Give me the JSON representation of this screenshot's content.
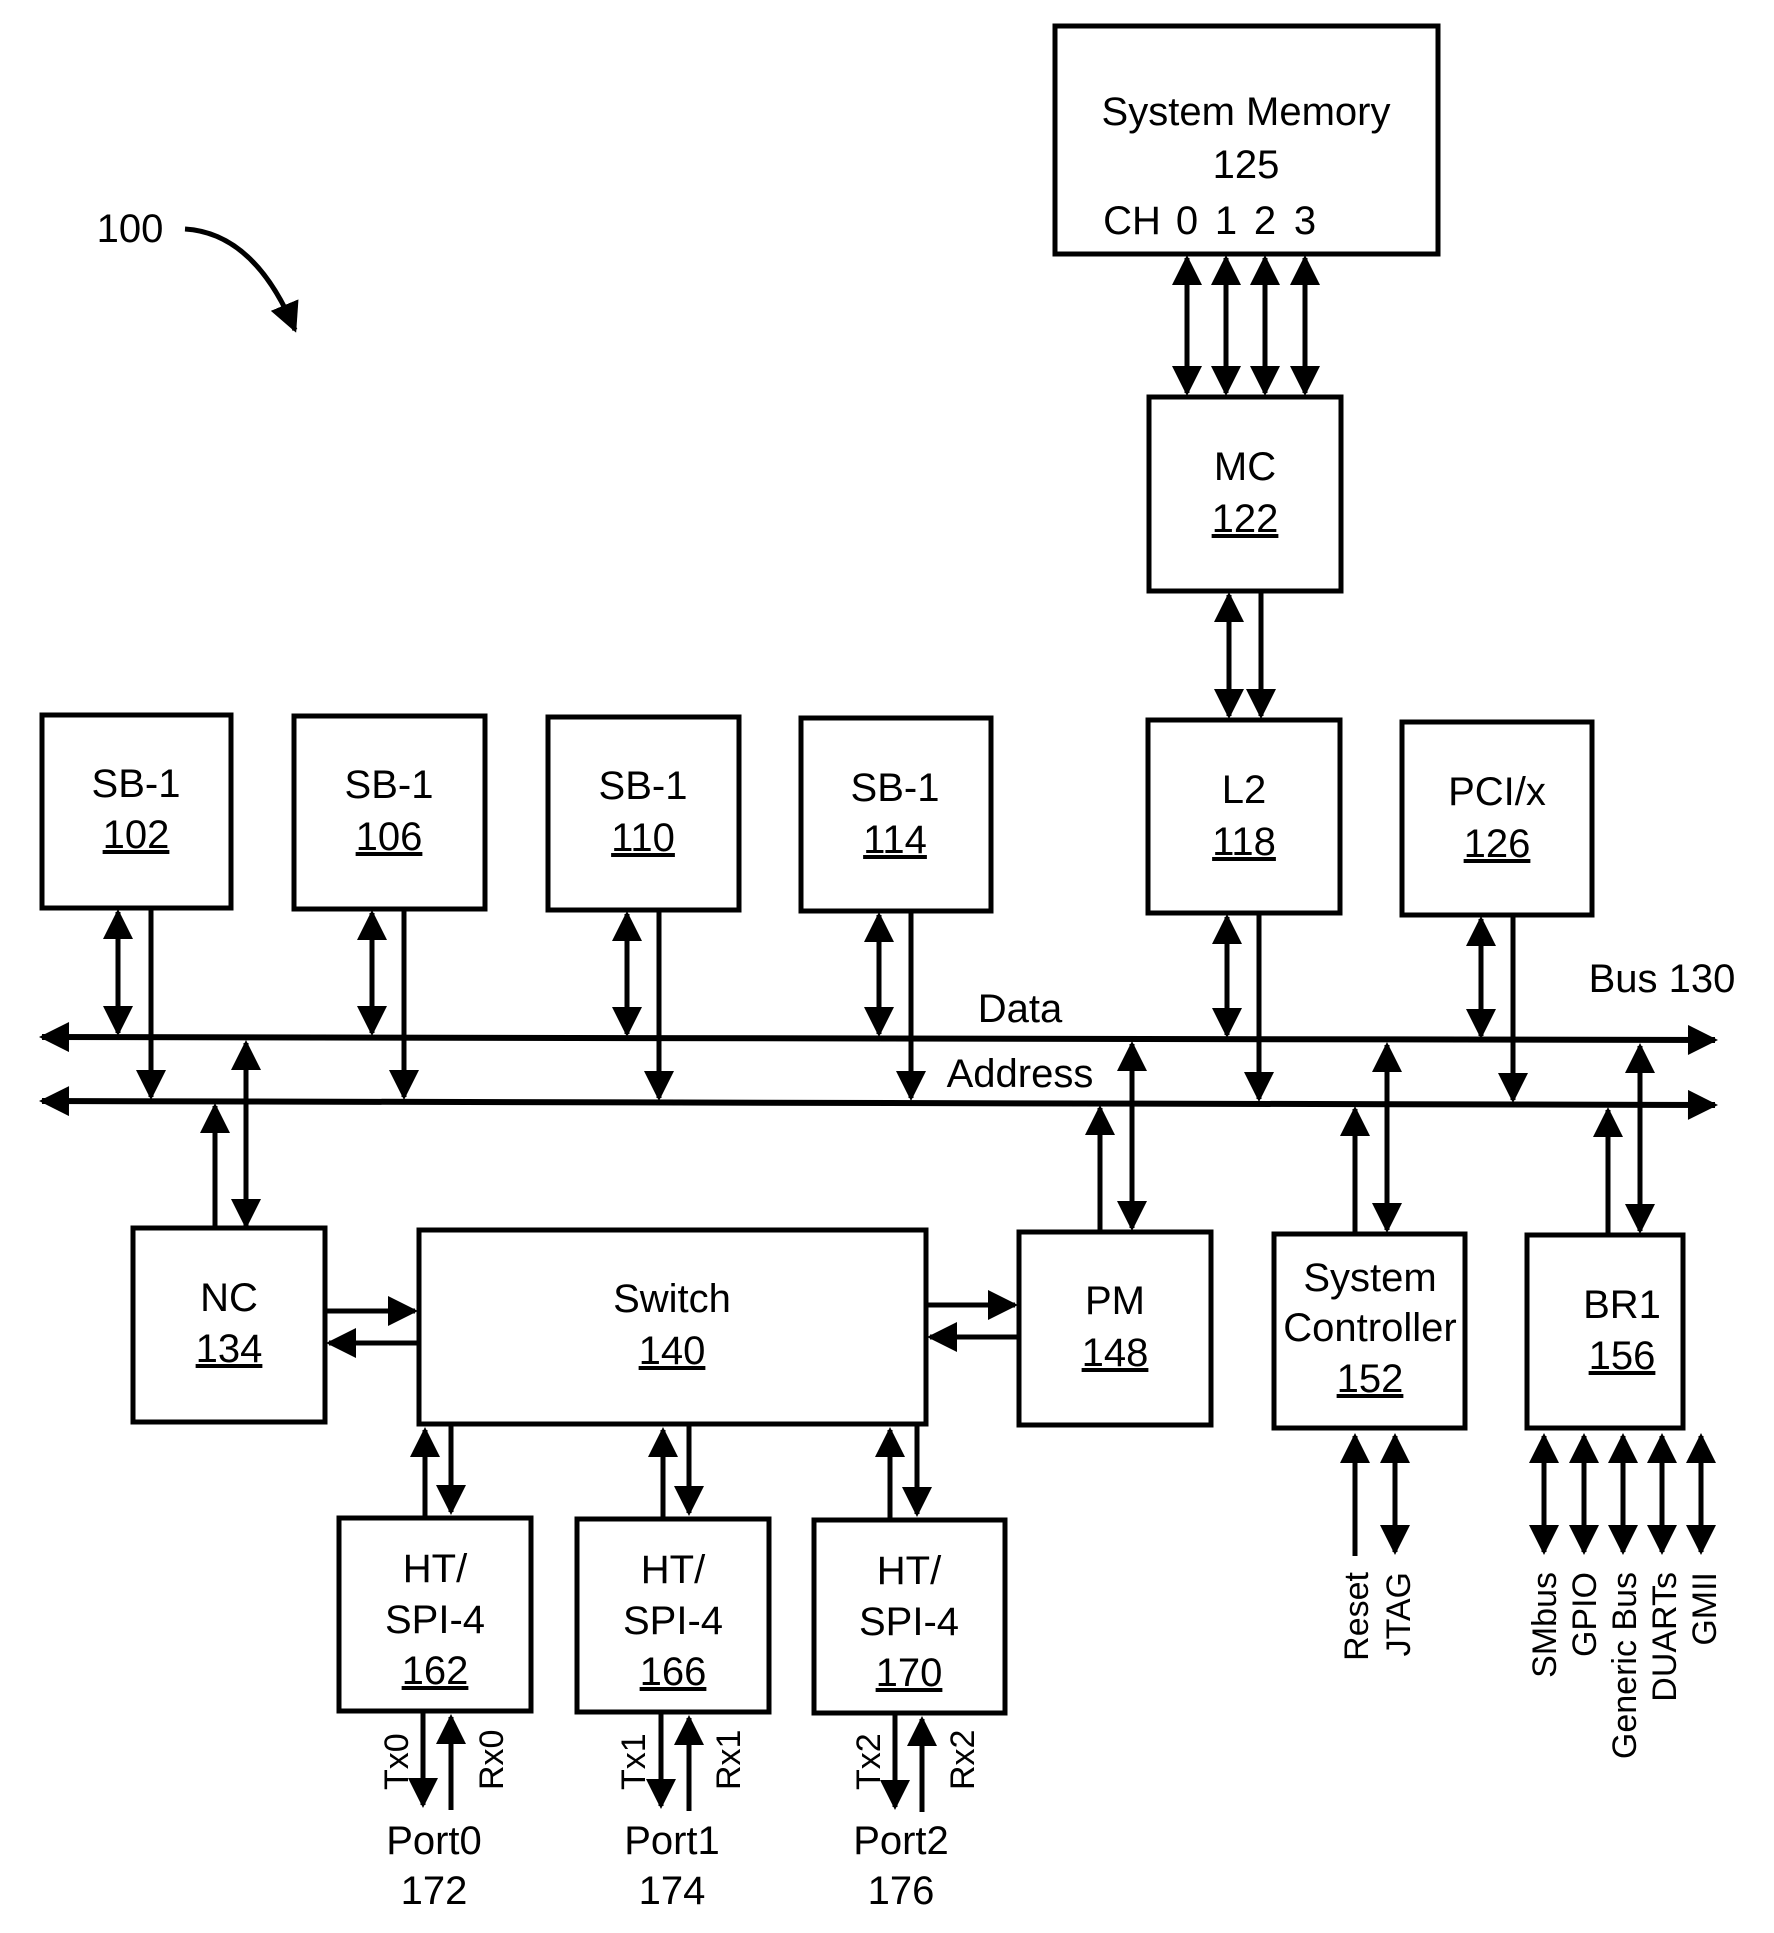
{
  "figure": {
    "reference_label": "100",
    "bus": {
      "label": "Bus 130",
      "data_label": "Data",
      "address_label": "Address"
    },
    "system_memory": {
      "title": "System Memory",
      "number": "125",
      "channels_label": "CH",
      "channels": [
        "0",
        "1",
        "2",
        "3"
      ]
    },
    "blocks": {
      "mc": {
        "name": "MC",
        "number": "122"
      },
      "l2": {
        "name": "L2",
        "number": "118"
      },
      "pci": {
        "name": "PCI/x",
        "number": "126"
      },
      "sb102": {
        "name": "SB-1",
        "number": "102"
      },
      "sb106": {
        "name": "SB-1",
        "number": "106"
      },
      "sb110": {
        "name": "SB-1",
        "number": "110"
      },
      "sb114": {
        "name": "SB-1",
        "number": "114"
      },
      "nc": {
        "name": "NC",
        "number": "134"
      },
      "switch": {
        "name": "Switch",
        "number": "140"
      },
      "pm": {
        "name": "PM",
        "number": "148"
      },
      "sysctrl": {
        "name_line1": "System",
        "name_line2": "Controller",
        "number": "152"
      },
      "br1": {
        "name": "BR1",
        "number": "156"
      },
      "ht162": {
        "line1": "HT/",
        "line2": "SPI-4",
        "number": "162"
      },
      "ht166": {
        "line1": "HT/",
        "line2": "SPI-4",
        "number": "166"
      },
      "ht170": {
        "line1": "HT/",
        "line2": "SPI-4",
        "number": "170"
      }
    },
    "ports": [
      {
        "tx": "Tx0",
        "rx": "Rx0",
        "name": "Port0",
        "number": "172"
      },
      {
        "tx": "Tx1",
        "rx": "Rx1",
        "name": "Port1",
        "number": "174"
      },
      {
        "tx": "Tx2",
        "rx": "Rx2",
        "name": "Port2",
        "number": "176"
      }
    ],
    "sysctrl_signals": [
      "Reset",
      "JTAG"
    ],
    "br1_signals": [
      "SMbus",
      "GPIO",
      "Generic Bus",
      "DUARTs",
      "GMII"
    ]
  }
}
